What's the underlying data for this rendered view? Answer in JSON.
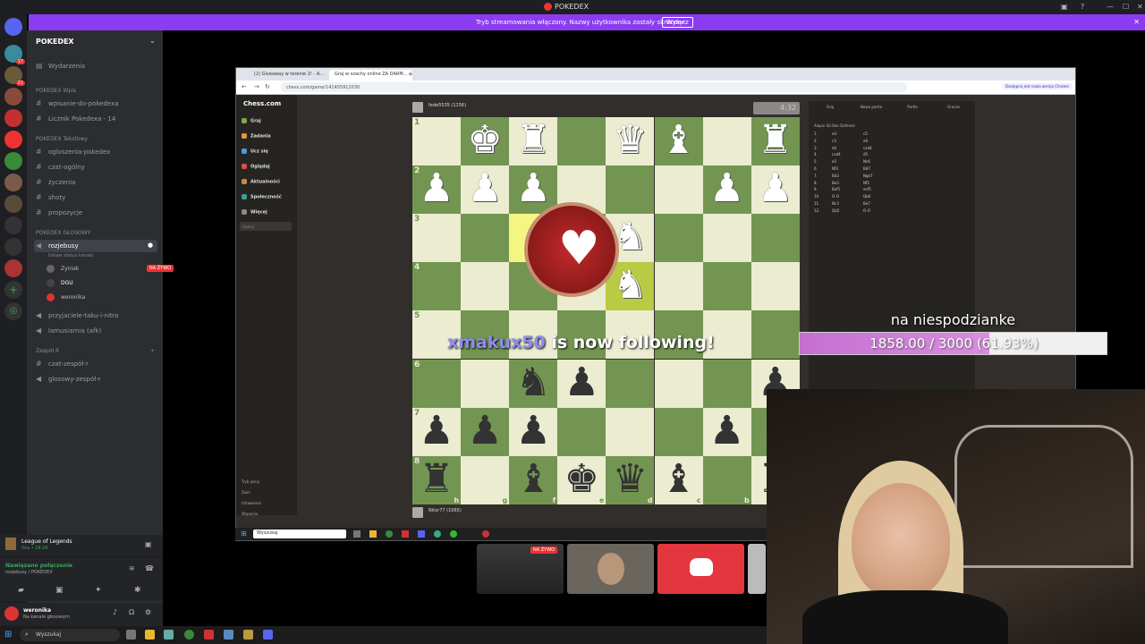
{
  "titlebar": {
    "title": "POKEDEX"
  },
  "streambar": {
    "message": "Tryb streamowania włączony. Nazwy użytkownika zostały skrócone.",
    "button": "Wyłącz"
  },
  "server": {
    "name": "POKEDEX",
    "events": "Wydarzenia",
    "categories": [
      {
        "name": "POKEDEX Wpis",
        "channels": [
          "wpisanie-do-pokedexa",
          "Licznik Pokedexa - 14"
        ]
      },
      {
        "name": "POKEDEX Tekstowy",
        "channels": [
          "ogloszenia-pokedex",
          "czat-ogólny",
          "życzenia",
          "shoty",
          "propozycje"
        ]
      },
      {
        "name": "POKEDEX GŁOSOWY",
        "channels": [
          "rozjebusy",
          "przyjaciele-taku-i-nitro",
          "lamusiarnia (afk)"
        ]
      },
      {
        "name": "Zespół R",
        "channels": [
          "czat-zespół-r",
          "glosowy-zespół-r"
        ]
      }
    ],
    "voice_status": "Ustaw status kanału",
    "voice_users": [
      "Zyniak",
      "DGU",
      "weronika"
    ],
    "live_label": "NA ŻYWO"
  },
  "game": {
    "name": "League of Legends",
    "status": "Gra • 19:26"
  },
  "voice": {
    "status": "Nawiązano połączenie",
    "channel": "rozjebusy / POKEDEX"
  },
  "user": {
    "name": "weronika",
    "status": "Na kanale głosowym"
  },
  "taskbar": {
    "search": "Wyszukaj"
  },
  "browser": {
    "tabs": [
      "(2) Giveaway w terenie 2! - A...",
      "Graj w szachy online ZA DARM..."
    ],
    "url": "chess.com/game/141455912030",
    "notice": "Dostępna jest nowa wersja Chrome"
  },
  "chess": {
    "logo": "Chess.com",
    "nav": [
      "Graj",
      "Zadania",
      "Ucz się",
      "Oglądaj",
      "Aktualności",
      "Społeczność",
      "Więcej"
    ],
    "search": "Szukaj",
    "nav_low": [
      "Tryb jasny",
      "Zwiń",
      "Ustawienia",
      "Wsparcie"
    ],
    "player_top": "fede5535 (1156)",
    "player_bottom": "Nitor77 (1065)",
    "clock": "4:32",
    "ranks": [
      "1",
      "2",
      "3",
      "4",
      "5",
      "6",
      "7",
      "8"
    ],
    "files": [
      "h",
      "g",
      "f",
      "e",
      "d",
      "c",
      "b"
    ],
    "tabs": [
      "Graj",
      "Nowa partia",
      "Partie",
      "Gracze"
    ],
    "opening": "Alapin Sicilian Defense",
    "moves": [
      [
        "1.",
        "e4",
        "c5"
      ],
      [
        "2.",
        "c3",
        "e6"
      ],
      [
        "3.",
        "d4",
        "cxd4"
      ],
      [
        "4.",
        "cxd4",
        "d5"
      ],
      [
        "5.",
        "e5",
        "Nc6"
      ],
      [
        "6.",
        "Nf3",
        "Bd7"
      ],
      [
        "7.",
        "Bd3",
        "Nge7"
      ],
      [
        "8.",
        "Be3",
        "Nf5"
      ],
      [
        "9.",
        "Bxf5",
        "exf5"
      ],
      [
        "10.",
        "O-O",
        "Qb6"
      ],
      [
        "11.",
        "Nc3",
        "Be7"
      ],
      [
        "12.",
        "Qd2",
        "O-O"
      ]
    ]
  },
  "overlay": {
    "follower": "xmakux50",
    "follow_text": " is now following!",
    "goal_title": "na niespodzianke",
    "goal_progress": "1858.00 / 3000 (61.93%)",
    "goal_fraction": 0.6193
  }
}
